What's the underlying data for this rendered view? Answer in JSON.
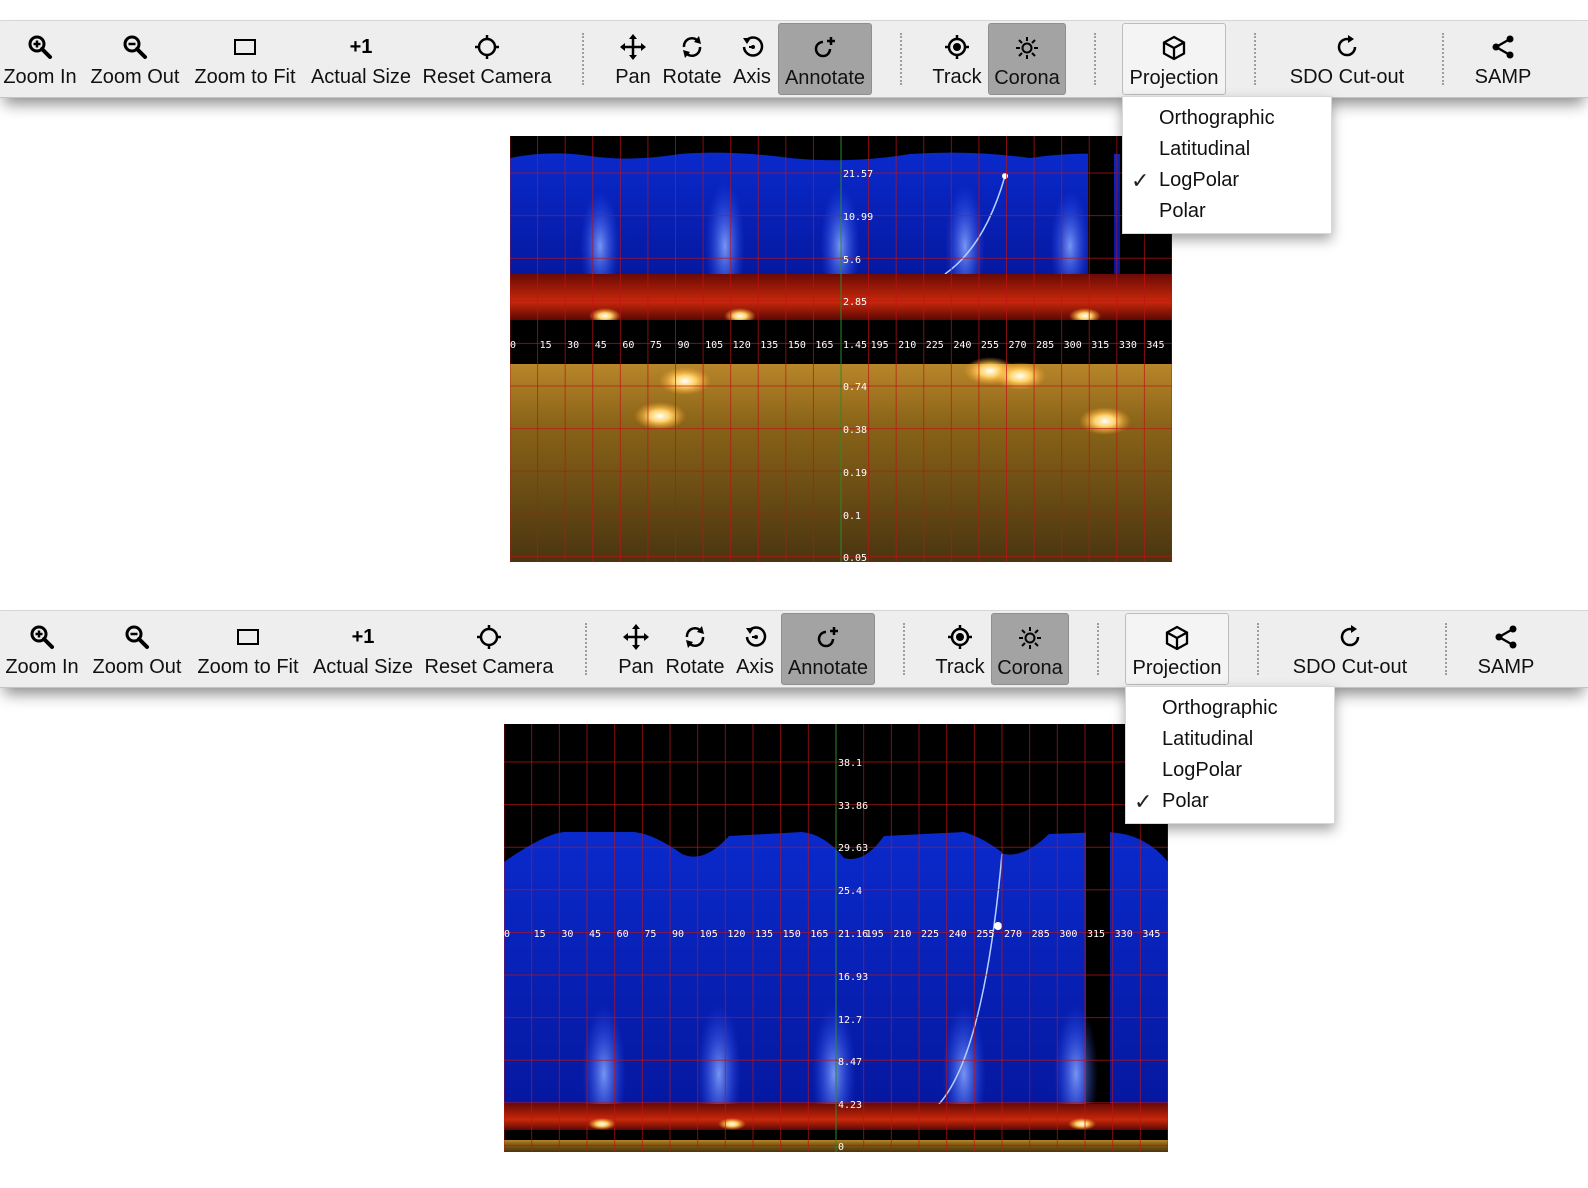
{
  "toolbar": {
    "buttons": [
      {
        "label": "Zoom In",
        "icon": "zoom-in-icon"
      },
      {
        "label": "Zoom Out",
        "icon": "zoom-out-icon"
      },
      {
        "label": "Zoom to Fit",
        "icon": "zoom-to-fit-icon"
      },
      {
        "label": "Actual Size",
        "icon": "actual-size-icon",
        "glyph": "+1"
      },
      {
        "label": "Reset Camera",
        "icon": "reset-camera-icon"
      },
      {
        "label": "Pan",
        "icon": "pan-icon"
      },
      {
        "label": "Rotate",
        "icon": "rotate-icon"
      },
      {
        "label": "Axis",
        "icon": "axis-icon"
      },
      {
        "label": "Annotate",
        "icon": "annotate-icon",
        "active": true
      },
      {
        "label": "Track",
        "icon": "track-icon"
      },
      {
        "label": "Corona",
        "icon": "corona-icon",
        "active": true
      },
      {
        "label": "Projection",
        "icon": "projection-icon",
        "open": true
      },
      {
        "label": "SDO Cut-out",
        "icon": "sdo-cutout-icon"
      },
      {
        "label": "SAMP",
        "icon": "share-icon"
      }
    ]
  },
  "projection_menu": {
    "options": [
      "Orthographic",
      "Latitudinal",
      "LogPolar",
      "Polar"
    ],
    "check_glyph": "✓"
  },
  "panels": [
    {
      "projection": "LogPolar",
      "x_ticks": [
        "0",
        "15",
        "30",
        "45",
        "60",
        "75",
        "90",
        "105",
        "120",
        "135",
        "150",
        "165",
        "1.45",
        "195",
        "210",
        "225",
        "240",
        "255",
        "270",
        "285",
        "300",
        "315",
        "330",
        "345"
      ],
      "y_ticks": [
        "21.57",
        "10.99",
        "5.6",
        "2.85",
        "0.74",
        "0.38",
        "0.19",
        "0.1",
        "0.05"
      ],
      "colors": {
        "corona": "#0a2acc",
        "limb": "#c8280a",
        "disk": "#8a6418"
      }
    },
    {
      "projection": "Polar",
      "x_ticks": [
        "0",
        "15",
        "30",
        "45",
        "60",
        "75",
        "90",
        "105",
        "120",
        "135",
        "150",
        "165",
        "21.16",
        "195",
        "210",
        "225",
        "240",
        "255",
        "270",
        "285",
        "300",
        "315",
        "330",
        "345"
      ],
      "y_ticks": [
        "38.1",
        "33.86",
        "29.63",
        "25.4",
        "16.93",
        "12.7",
        "8.47",
        "4.23",
        "0"
      ],
      "colors": {
        "corona": "#0a2acc",
        "limb": "#c8280a",
        "disk": "#8a6418"
      }
    }
  ]
}
